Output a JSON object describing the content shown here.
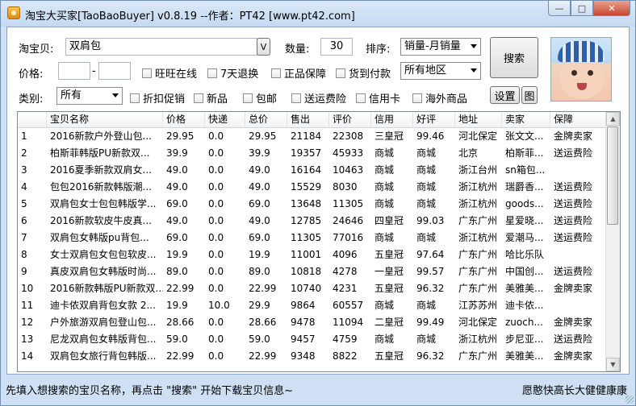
{
  "window": {
    "title": "淘宝大买家[TaoBaoBuyer] v0.8.19 --作者：PT42 [www.pt42.com]",
    "min_glyph": "—",
    "max_glyph": "□",
    "close_glyph": "✕"
  },
  "search": {
    "product_label": "淘宝贝:",
    "product_value": "双肩包",
    "dropdown_btn": "V",
    "qty_label": "数量:",
    "qty_value": "30",
    "sort_label": "排序:",
    "sort_value": "销量-月销量",
    "price_label": "价格:",
    "price_from": "",
    "price_sep": "-",
    "price_to": "",
    "region_value": "所有地区",
    "category_label": "类别:",
    "category_value": "所有",
    "search_button": "搜索",
    "settings_button": "设置",
    "image_button": "图"
  },
  "filters": {
    "wangwang": "旺旺在线",
    "return7": "7天退换",
    "genuine": "正品保障",
    "cod": "货到付款",
    "discount": "折扣促销",
    "new": "新品",
    "free_shipping": "包邮",
    "shipping_insurance": "送运费险",
    "credit_card": "信用卡",
    "overseas": "海外商品"
  },
  "table": {
    "columns": [
      "",
      "宝贝名称",
      "价格",
      "快递",
      "总价",
      "售出",
      "评价",
      "信用",
      "好评",
      "地址",
      "卖家",
      "保障"
    ],
    "rows": [
      [
        "1",
        "2016新款户外登山包...",
        "29.95",
        "0.0",
        "29.95",
        "21184",
        "22308",
        "三皇冠",
        "99.46",
        "河北保定",
        "张文文...",
        "金牌卖家"
      ],
      [
        "2",
        "柏斯菲韩版PU新款双...",
        "39.9",
        "0.0",
        "39.9",
        "19357",
        "45933",
        "商城",
        "商城",
        "北京",
        "柏斯菲...",
        "送运费险"
      ],
      [
        "3",
        "2016夏季新款双肩女...",
        "49.0",
        "0.0",
        "49.0",
        "16164",
        "10463",
        "商城",
        "商城",
        "浙江台州",
        "sn箱包...",
        ""
      ],
      [
        "4",
        "包包2016新款韩版潮...",
        "49.0",
        "0.0",
        "49.0",
        "15529",
        "8030",
        "商城",
        "商城",
        "浙江杭州",
        "瑞爵香...",
        "送运费险"
      ],
      [
        "5",
        "双肩包女士包包韩版学...",
        "69.0",
        "0.0",
        "69.0",
        "13648",
        "11305",
        "商城",
        "商城",
        "浙江杭州",
        "goods...",
        "送运费险"
      ],
      [
        "6",
        "2016新款软皮牛皮真...",
        "49.0",
        "0.0",
        "49.0",
        "12785",
        "24646",
        "四皇冠",
        "99.03",
        "广东广州",
        "星爱晓...",
        "送运费险"
      ],
      [
        "7",
        "双肩包女韩版pu背包...",
        "69.0",
        "0.0",
        "69.0",
        "11305",
        "77016",
        "商城",
        "商城",
        "浙江杭州",
        "爱潮马...",
        "送运费险"
      ],
      [
        "8",
        "女士双肩包女包包软皮...",
        "19.9",
        "0.0",
        "19.9",
        "11001",
        "4096",
        "五皇冠",
        "97.64",
        "广东广州",
        "哈比乐队",
        ""
      ],
      [
        "9",
        "真皮双肩包女韩版时尚...",
        "89.0",
        "0.0",
        "89.0",
        "10818",
        "4278",
        "一皇冠",
        "99.57",
        "广东广州",
        "中国创...",
        "送运费险"
      ],
      [
        "10",
        "2016新款韩版PU新款双...",
        "22.99",
        "0.0",
        "22.99",
        "10740",
        "4231",
        "五皇冠",
        "96.32",
        "广东广州",
        "美雅美...",
        "金牌卖家"
      ],
      [
        "11",
        "迪卡侬双肩背包女款 2...",
        "19.9",
        "10.0",
        "29.9",
        "9864",
        "60557",
        "商城",
        "商城",
        "江苏苏州",
        "迪卡侬...",
        ""
      ],
      [
        "12",
        "户外旅游双肩包登山包...",
        "28.66",
        "0.0",
        "28.66",
        "9478",
        "11094",
        "二皇冠",
        "99.49",
        "河北保定",
        "zuoch...",
        "金牌卖家"
      ],
      [
        "13",
        "尼龙双肩包女韩版背包...",
        "59.0",
        "0.0",
        "59.0",
        "9457",
        "4759",
        "商城",
        "商城",
        "浙江杭州",
        "步尼亚...",
        "送运费险"
      ],
      [
        "14",
        "双肩包女旅行背包韩版...",
        "22.99",
        "0.0",
        "22.99",
        "9348",
        "8822",
        "五皇冠",
        "96.32",
        "广东广州",
        "美雅美...",
        "金牌卖家"
      ]
    ]
  },
  "status": {
    "hint": "先填入想搜索的宝贝名称，再点击 \"搜索\" 开始下载宝贝信息~",
    "blessing": "愿憨快高长大健健康康"
  }
}
